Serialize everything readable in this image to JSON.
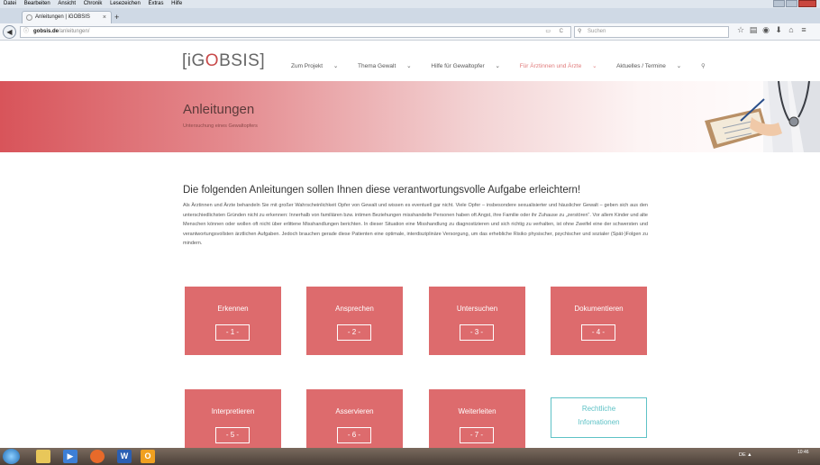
{
  "browser": {
    "menu": [
      "Datei",
      "Bearbeiten",
      "Ansicht",
      "Chronik",
      "Lesezeichen",
      "Extras",
      "Hilfe"
    ],
    "tab_title": "Anleitungen | iGOBSIS",
    "tab_close": "×",
    "new_tab": "+",
    "url_domain": "gobsis.de",
    "url_path": "/anleitungen/",
    "search_placeholder": "Suchen"
  },
  "site": {
    "logo": {
      "pre": "[iG",
      "o": "O",
      "post": "BSIS]"
    },
    "nav": [
      {
        "label": "Zum Projekt",
        "active": false
      },
      {
        "label": "Thema Gewalt",
        "active": false
      },
      {
        "label": "Hilfe für Gewaltopfer",
        "active": false
      },
      {
        "label": "Für Ärztinnen und Ärzte",
        "active": true
      },
      {
        "label": "Aktuelles / Termine",
        "active": false
      }
    ],
    "nav_suffix": "⌄"
  },
  "hero": {
    "title": "Anleitungen",
    "subtitle": "Untersuchung eines Gewaltopfers"
  },
  "content": {
    "heading": "Die folgenden Anleitungen sollen Ihnen diese verantwortungsvolle Aufgabe erleichtern!",
    "intro": "Als Ärztinnen und Ärzte behandeln Sie mit großer Wahrscheinlichkeit Opfer von Gewalt und wissen es eventuell gar nicht. Viele Opfer – insbesondere sexualisierter und häuslicher Gewalt – geben sich aus den unterschiedlichsten Gründen nicht zu erkennen: Innerhalb von familiären bzw. intimen Beziehungen misshandelte Personen haben oft Angst, ihre Familie oder ihr Zuhause zu „zerstören“. Vor allem Kinder und alte Menschen können oder wollen oft nicht über erlittene Misshandlungen berichten. In dieser Situation eine Misshandlung zu diagnostizieren und sich richtig zu verhalten, ist ohne Zweifel eine der schwersten und verantwortungsvollsten ärztlichen Aufgaben. Jedoch brauchen gerade diese Patienten eine optimale, interdisziplinäre Versorgung, um das erhebliche Risiko physischer, psychischer und sozialer (Spät-)Folgen zu mindern."
  },
  "cards": [
    {
      "label": "Erkennen",
      "number": "- 1 -"
    },
    {
      "label": "Ansprechen",
      "number": "- 2 -"
    },
    {
      "label": "Untersuchen",
      "number": "- 3 -"
    },
    {
      "label": "Dokumentieren",
      "number": "- 4 -"
    },
    {
      "label": "Interpretieren",
      "number": "- 5 -"
    },
    {
      "label": "Asservieren",
      "number": "- 6 -"
    },
    {
      "label": "Weiterleiten",
      "number": "- 7 -"
    }
  ],
  "outline_card": {
    "line1": "Rechtliche",
    "line2": "Infomationen"
  },
  "taskbar": {
    "items": [
      {
        "icon": "explorer-icon",
        "color": "#e8c75a",
        "text": ""
      },
      {
        "icon": "media-player-icon",
        "color": "#3d7fd6",
        "text": "▶"
      },
      {
        "icon": "firefox-icon",
        "color": "#e86a2a",
        "text": ""
      },
      {
        "icon": "word-icon",
        "color": "#2b5fb3",
        "text": "W"
      },
      {
        "icon": "outlook-icon",
        "color": "#f0a020",
        "text": "O"
      }
    ],
    "tray": "DE  ▲",
    "time": "10:46"
  },
  "colors": {
    "card": "#dd6b6d",
    "accent": "#5ec2c6",
    "hero_start": "#d8545a"
  }
}
